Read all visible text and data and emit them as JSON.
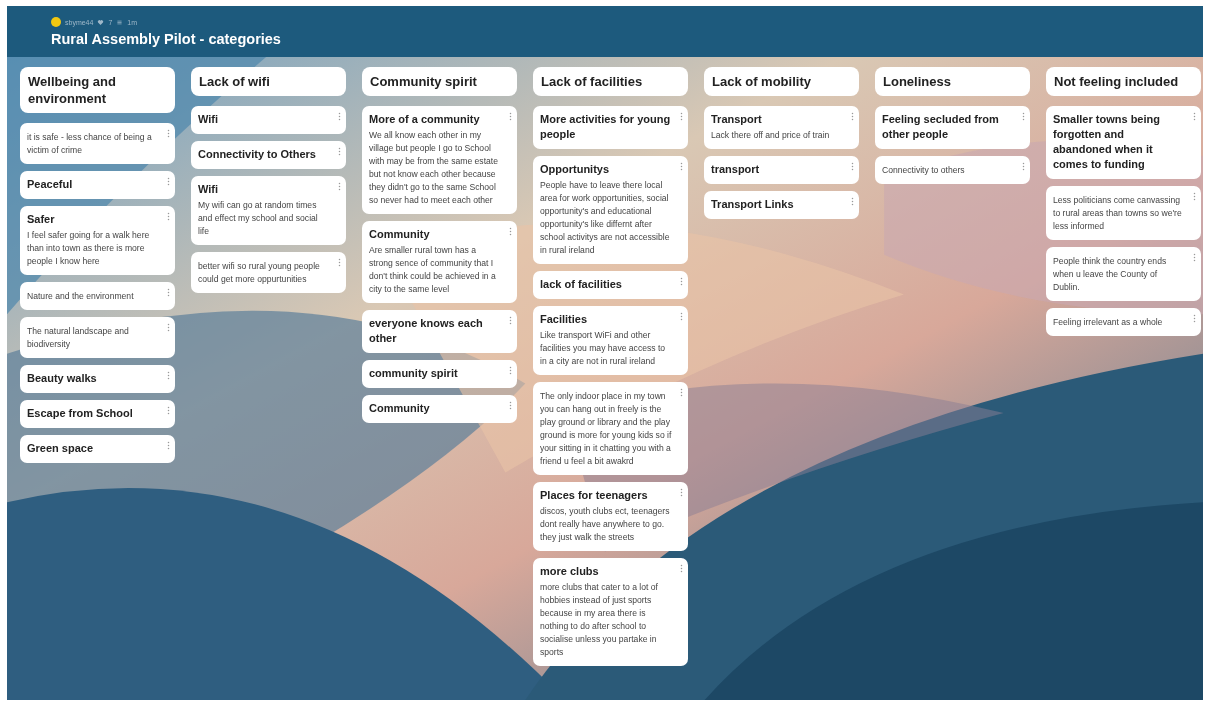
{
  "board": {
    "author": "sbyme44",
    "count": "7",
    "time": "1m",
    "title": "Rural Assembly Pilot - categories"
  },
  "columns": [
    {
      "title": "Wellbeing and environment",
      "cards": [
        {
          "body": "it is safe - less chance of being a victim of crime"
        },
        {
          "subject": "Peaceful"
        },
        {
          "subject": "Safer",
          "body": "I feel safer going for a walk here than into town as there is more people I know here"
        },
        {
          "body": "Nature and the environment"
        },
        {
          "body": "The natural landscape and biodiversity"
        },
        {
          "subject": "Beauty walks"
        },
        {
          "subject": "Escape from School"
        },
        {
          "subject": "Green space"
        }
      ]
    },
    {
      "title": "Lack of wifi",
      "cards": [
        {
          "subject": "Wifi"
        },
        {
          "subject": "Connectivity to Others"
        },
        {
          "subject": "Wifi",
          "body": "My wifi can go at random times and effect my school and social life"
        },
        {
          "body": "better wifi so rural young people could get more oppurtunities"
        }
      ]
    },
    {
      "title": "Community spirit",
      "cards": [
        {
          "subject": "More of a community",
          "body": "We all know each other in my village but people I go to School with may be from the same estate but not know each other because they didn't go to the same School so never had to meet each other"
        },
        {
          "subject": "Community",
          "body": "Are smaller rural town has a strong sence of community that I don't think could be achieved in a city to the same level"
        },
        {
          "subject": "everyone knows each other"
        },
        {
          "subject": "community spirit"
        },
        {
          "subject": "Community"
        }
      ]
    },
    {
      "title": "Lack of facilities",
      "cards": [
        {
          "subject": "More activities for young people"
        },
        {
          "subject": "Opportunitys",
          "body": "People have to leave there local area for work opportunities, social opportunity's and educational opportunity's like differnt after school activitys are not accessible in rural ireland"
        },
        {
          "subject": "lack of facilities"
        },
        {
          "subject": "Facilities",
          "body": "Like transport WiFi and other facilities you may have access to in a city are not in rural ireland"
        },
        {
          "body": "The only indoor place in my town you can hang out in freely is the play ground or library and the play ground is more for young kids so if your sitting in it chatting you with a friend u feel a bit awakrd"
        },
        {
          "subject": "Places for teenagers",
          "body": "discos, youth clubs ect, teenagers dont really have anywhere to go. they just walk the streets"
        },
        {
          "subject": "more clubs",
          "body": "more clubs that cater to a lot of hobbies instead of just sports because in my area there is nothing to do after school to socialise unless you partake in sports"
        }
      ]
    },
    {
      "title": "Lack of mobility",
      "cards": [
        {
          "subject": "Transport",
          "body": "Lack there off and price of train"
        },
        {
          "subject": "transport"
        },
        {
          "subject": "Transport Links"
        }
      ]
    },
    {
      "title": "Loneliness",
      "cards": [
        {
          "subject": "Feeling secluded from other people"
        },
        {
          "body": "Connectivity to others"
        }
      ]
    },
    {
      "title": "Not feeling included",
      "cards": [
        {
          "subject": "Smaller towns being forgotten and abandoned when it comes to funding"
        },
        {
          "body": "Less politicians come canvassing to rural areas than towns so we're less informed"
        },
        {
          "body": "People think the country ends when u leave the County of Dublin."
        },
        {
          "body": "Feeling irrelevant as a whole"
        }
      ]
    }
  ]
}
